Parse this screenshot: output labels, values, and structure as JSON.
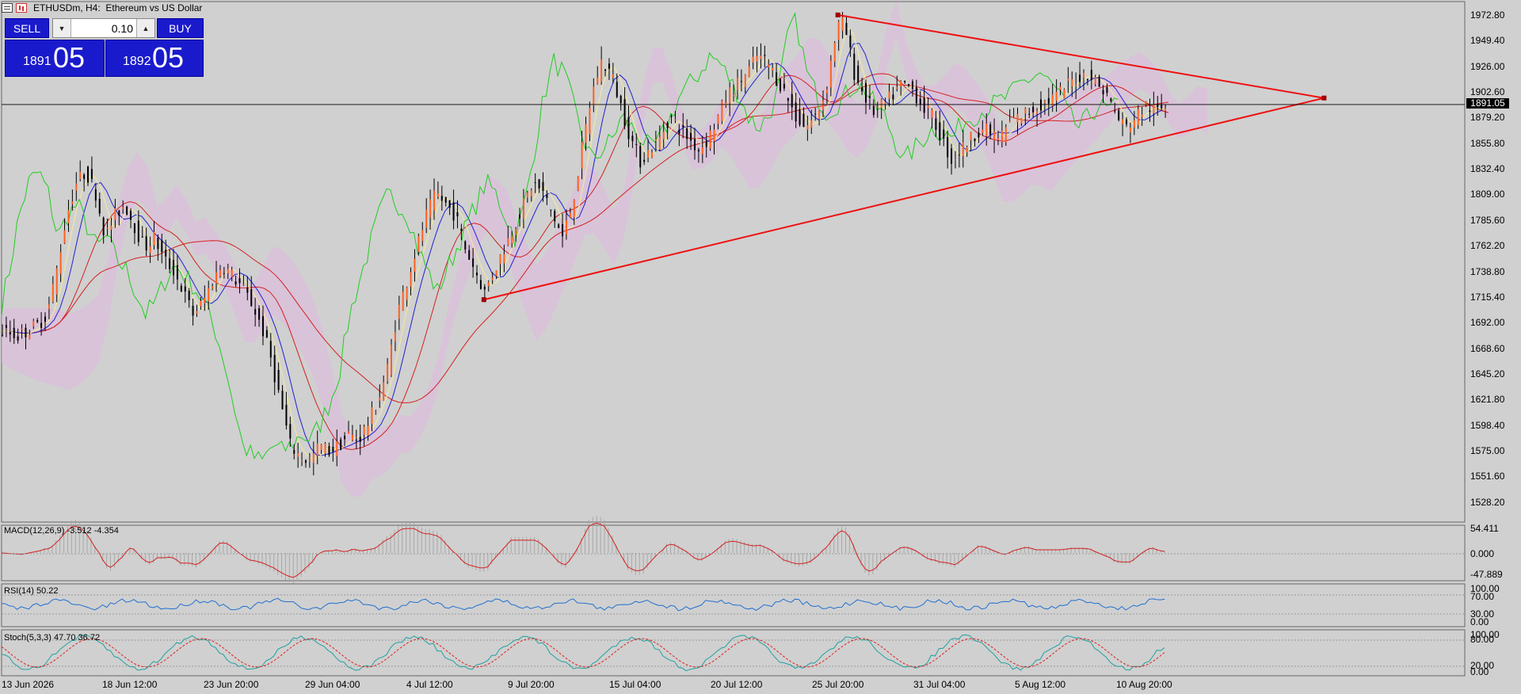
{
  "window": {
    "symbol": "ETHUSDm",
    "timeframe": "H4",
    "description": "Ethereum vs US Dollar"
  },
  "trade_panel": {
    "sell_label": "SELL",
    "buy_label": "BUY",
    "lot_value": "0.10",
    "sell_price_small": "1891",
    "sell_price_big": "05",
    "buy_price_small": "1892",
    "buy_price_big": "05",
    "down_arrow": "▼",
    "up_arrow": "▲",
    "button_color": "#1a1acd"
  },
  "price_axis": {
    "labels": [
      "1972.80",
      "1949.40",
      "1926.00",
      "1902.60",
      "1879.20",
      "1855.80",
      "1832.40",
      "1809.00",
      "1785.60",
      "1762.20",
      "1738.80",
      "1715.40",
      "1692.00",
      "1668.60",
      "1645.20",
      "1621.80",
      "1598.40",
      "1575.00",
      "1551.60",
      "1528.20"
    ],
    "current_price": "1891.05"
  },
  "time_axis": {
    "labels": [
      "13 Jun 2026",
      "18 Jun 12:00",
      "23 Jun 20:00",
      "29 Jun 04:00",
      "4 Jul 12:00",
      "9 Jul 20:00",
      "15 Jul 04:00",
      "20 Jul 12:00",
      "25 Jul 20:00",
      "31 Jul 04:00",
      "5 Aug 12:00",
      "10 Aug 20:00"
    ]
  },
  "indicators": {
    "macd": {
      "label": "MACD(12,26,9) -3.512 -4.354",
      "ticks": [
        "54.411",
        "0.000",
        "-47.889"
      ]
    },
    "rsi": {
      "label": "RSI(14) 50.22",
      "ticks": [
        "100.00",
        "70.00",
        "30.00",
        "0.00"
      ]
    },
    "stoch": {
      "label": "Stoch(5,3,3) 47.70 36.72",
      "ticks": [
        "100.00",
        "80.00",
        "20.00",
        "0.00"
      ]
    }
  },
  "chart_data": {
    "type": "candlestick",
    "symbol": "ETHUSDm",
    "timeframe": "H4",
    "ylim": [
      1510,
      1985
    ],
    "close_path": [
      [
        0,
        1685
      ],
      [
        10,
        1680
      ],
      [
        20,
        1690
      ],
      [
        25,
        1700
      ],
      [
        30,
        1740
      ],
      [
        35,
        1790
      ],
      [
        40,
        1820
      ],
      [
        45,
        1830
      ],
      [
        50,
        1810
      ],
      [
        55,
        1770
      ],
      [
        60,
        1790
      ],
      [
        65,
        1800
      ],
      [
        70,
        1780
      ],
      [
        75,
        1760
      ],
      [
        80,
        1770
      ],
      [
        85,
        1750
      ],
      [
        90,
        1740
      ],
      [
        95,
        1720
      ],
      [
        100,
        1700
      ],
      [
        105,
        1710
      ],
      [
        110,
        1730
      ],
      [
        115,
        1745
      ],
      [
        120,
        1735
      ],
      [
        125,
        1725
      ],
      [
        130,
        1710
      ],
      [
        135,
        1690
      ],
      [
        140,
        1660
      ],
      [
        145,
        1620
      ],
      [
        150,
        1580
      ],
      [
        155,
        1570
      ],
      [
        160,
        1565
      ],
      [
        165,
        1580
      ],
      [
        170,
        1575
      ],
      [
        175,
        1580
      ],
      [
        180,
        1590
      ],
      [
        185,
        1585
      ],
      [
        190,
        1600
      ],
      [
        195,
        1620
      ],
      [
        200,
        1650
      ],
      [
        205,
        1700
      ],
      [
        210,
        1730
      ],
      [
        215,
        1760
      ],
      [
        220,
        1790
      ],
      [
        225,
        1810
      ],
      [
        230,
        1800
      ],
      [
        235,
        1790
      ],
      [
        240,
        1760
      ],
      [
        245,
        1740
      ],
      [
        250,
        1720
      ],
      [
        255,
        1740
      ],
      [
        260,
        1760
      ],
      [
        265,
        1780
      ],
      [
        270,
        1800
      ],
      [
        275,
        1820
      ],
      [
        280,
        1810
      ],
      [
        285,
        1790
      ],
      [
        290,
        1770
      ],
      [
        295,
        1800
      ],
      [
        300,
        1850
      ],
      [
        305,
        1900
      ],
      [
        310,
        1930
      ],
      [
        315,
        1920
      ],
      [
        320,
        1890
      ],
      [
        325,
        1860
      ],
      [
        330,
        1840
      ],
      [
        335,
        1850
      ],
      [
        340,
        1860
      ],
      [
        345,
        1880
      ],
      [
        350,
        1870
      ],
      [
        355,
        1860
      ],
      [
        360,
        1850
      ],
      [
        365,
        1860
      ],
      [
        370,
        1880
      ],
      [
        375,
        1900
      ],
      [
        380,
        1910
      ],
      [
        385,
        1920
      ],
      [
        390,
        1935
      ],
      [
        395,
        1930
      ],
      [
        400,
        1915
      ],
      [
        405,
        1900
      ],
      [
        410,
        1880
      ],
      [
        415,
        1870
      ],
      [
        420,
        1880
      ],
      [
        425,
        1900
      ],
      [
        430,
        1950
      ],
      [
        433,
        1970
      ],
      [
        436,
        1955
      ],
      [
        440,
        1920
      ],
      [
        445,
        1900
      ],
      [
        450,
        1885
      ],
      [
        455,
        1890
      ],
      [
        460,
        1900
      ],
      [
        465,
        1910
      ],
      [
        470,
        1905
      ],
      [
        475,
        1890
      ],
      [
        480,
        1880
      ],
      [
        485,
        1860
      ],
      [
        490,
        1840
      ],
      [
        495,
        1850
      ],
      [
        500,
        1860
      ],
      [
        505,
        1870
      ],
      [
        510,
        1865
      ],
      [
        515,
        1860
      ],
      [
        520,
        1875
      ],
      [
        525,
        1880
      ],
      [
        530,
        1885
      ],
      [
        535,
        1890
      ],
      [
        540,
        1895
      ],
      [
        545,
        1900
      ],
      [
        550,
        1910
      ],
      [
        555,
        1915
      ],
      [
        560,
        1920
      ],
      [
        565,
        1910
      ],
      [
        570,
        1900
      ],
      [
        575,
        1880
      ],
      [
        580,
        1870
      ],
      [
        585,
        1880
      ],
      [
        590,
        1890
      ],
      [
        595,
        1885
      ],
      [
        600,
        1890
      ]
    ],
    "trendline_upper": [
      [
        430,
        1972.8
      ],
      [
        680,
        1897
      ]
    ],
    "trendline_lower": [
      [
        248,
        1713
      ],
      [
        680,
        1897
      ]
    ],
    "current_price": 1891.05
  }
}
